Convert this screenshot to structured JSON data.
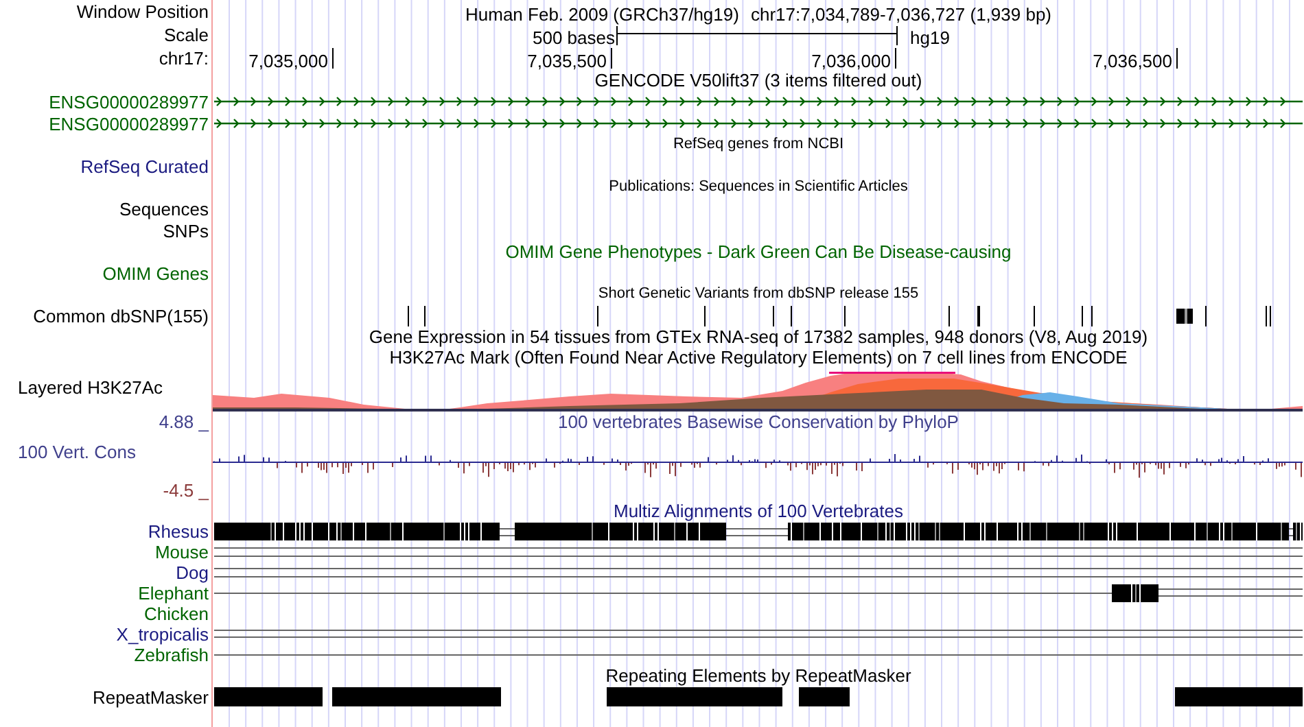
{
  "header": {
    "position_label": "Window Position",
    "assembly_title": "Human Feb. 2009 (GRCh37/hg19)",
    "position": "chr17:7,034,789-7,036,727 (1,939 bp)",
    "scale_label": "Scale",
    "scale_text": "500 bases",
    "scale_assembly": "hg19",
    "chrom_label": "chr17:",
    "ticks": [
      "7,035,000",
      "7,035,500",
      "7,036,000",
      "7,036,500"
    ]
  },
  "tracks": [
    {
      "kind": "genes",
      "title": {
        "text": "GENCODE V50lift37 (3 items filtered out)",
        "color": "#000000",
        "small": false
      },
      "rows": [
        {
          "label": "ENSG00000289977",
          "color": "#006400"
        },
        {
          "label": "ENSG00000289977",
          "color": "#006400"
        }
      ]
    },
    {
      "kind": "labels",
      "title": {
        "text": "RefSeq genes from NCBI",
        "color": "#000000",
        "small": true
      },
      "rows": [
        {
          "label": "RefSeq Curated",
          "color": "#1a1a80"
        }
      ]
    },
    {
      "kind": "labels",
      "title": {
        "text": "Publications: Sequences in Scientific Articles",
        "color": "#000000",
        "small": true
      },
      "rows": [
        {
          "label": "Sequences",
          "color": "#000000"
        },
        {
          "label": "SNPs",
          "color": "#000000"
        }
      ]
    },
    {
      "kind": "labels",
      "title": {
        "text": "OMIM Gene Phenotypes - Dark Green Can Be Disease-causing",
        "color": "#006400",
        "small": false
      },
      "rows": [
        {
          "label": "OMIM Genes",
          "color": "#006400"
        }
      ]
    },
    {
      "kind": "snps",
      "title": {
        "text": "Short Genetic Variants from dbSNP release 155",
        "color": "#000000",
        "small": true
      },
      "rows": [
        {
          "label": "Common dbSNP(155)",
          "color": "#000000"
        }
      ]
    },
    {
      "kind": "labels",
      "title": {
        "text": "Gene Expression in 54 tissues from GTEx RNA-seq of 17382 samples, 948 donors (V8, Aug 2019)",
        "color": "#000000",
        "small": false
      }
    },
    {
      "kind": "signal",
      "title": {
        "text": "H3K27Ac Mark (Often Found Near Active Regulatory Elements) on 7 cell lines from ENCODE",
        "color": "#000000",
        "small": false
      },
      "rows": [
        {
          "label": "Layered H3K27Ac",
          "color": "#000000"
        }
      ]
    },
    {
      "kind": "conservation",
      "title": {
        "text": "100 vertebrates Basewise Conservation by PhyloP",
        "color": "#40408c",
        "small": false
      },
      "upper": {
        "label": "4.88 _",
        "color": "#40408c"
      },
      "rows": [
        {
          "label": "100 Vert. Cons",
          "color": "#40408c"
        }
      ],
      "lower": {
        "label": "-4.5 _",
        "color": "#8b3a3a"
      }
    },
    {
      "kind": "alignment",
      "title": {
        "text": "Multiz Alignments of 100 Vertebrates",
        "color": "#1a1a80",
        "small": false
      },
      "rows": [
        {
          "label": "Rhesus",
          "color": "#1a1a80"
        },
        {
          "label": "Mouse",
          "color": "#006400"
        },
        {
          "label": "Dog",
          "color": "#1a1a80"
        },
        {
          "label": "Elephant",
          "color": "#006400"
        },
        {
          "label": "Chicken",
          "color": "#006400"
        },
        {
          "label": "X_tropicalis",
          "color": "#1a1a80"
        },
        {
          "label": "Zebrafish",
          "color": "#006400"
        }
      ]
    },
    {
      "kind": "repeats",
      "title": {
        "text": "Repeating Elements by RepeatMasker",
        "color": "#000000",
        "small": false
      },
      "rows": [
        {
          "label": "RepeatMasker",
          "color": "#000000"
        }
      ]
    }
  ]
}
